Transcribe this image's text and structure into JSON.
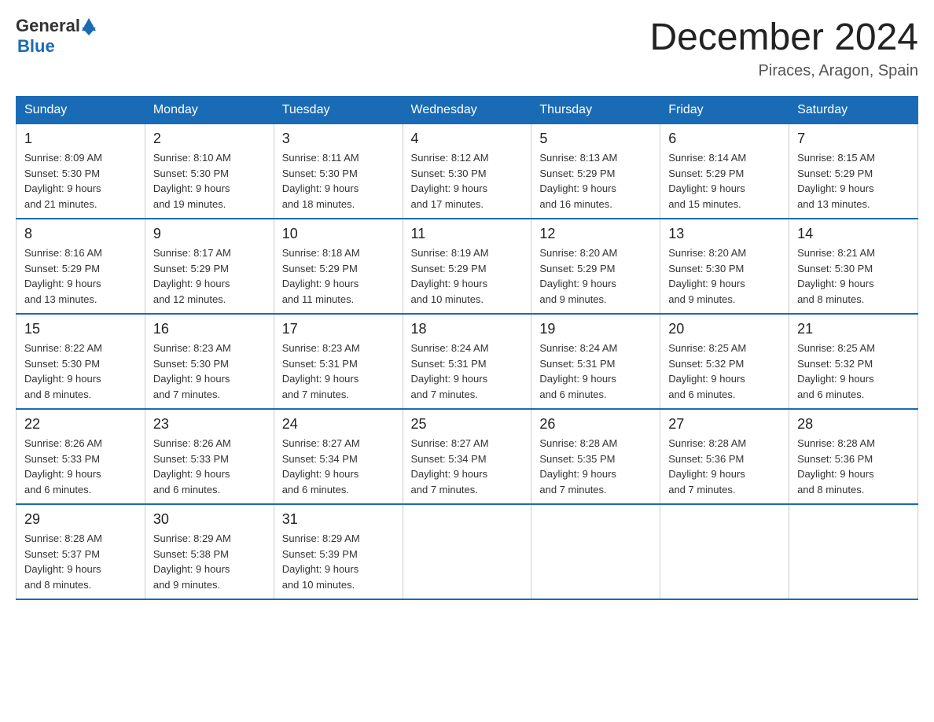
{
  "logo": {
    "general": "General",
    "blue": "Blue"
  },
  "header": {
    "month_year": "December 2024",
    "location": "Piraces, Aragon, Spain"
  },
  "weekdays": [
    "Sunday",
    "Monday",
    "Tuesday",
    "Wednesday",
    "Thursday",
    "Friday",
    "Saturday"
  ],
  "weeks": [
    [
      {
        "day": "1",
        "sunrise": "8:09 AM",
        "sunset": "5:30 PM",
        "daylight": "9 hours and 21 minutes."
      },
      {
        "day": "2",
        "sunrise": "8:10 AM",
        "sunset": "5:30 PM",
        "daylight": "9 hours and 19 minutes."
      },
      {
        "day": "3",
        "sunrise": "8:11 AM",
        "sunset": "5:30 PM",
        "daylight": "9 hours and 18 minutes."
      },
      {
        "day": "4",
        "sunrise": "8:12 AM",
        "sunset": "5:30 PM",
        "daylight": "9 hours and 17 minutes."
      },
      {
        "day": "5",
        "sunrise": "8:13 AM",
        "sunset": "5:29 PM",
        "daylight": "9 hours and 16 minutes."
      },
      {
        "day": "6",
        "sunrise": "8:14 AM",
        "sunset": "5:29 PM",
        "daylight": "9 hours and 15 minutes."
      },
      {
        "day": "7",
        "sunrise": "8:15 AM",
        "sunset": "5:29 PM",
        "daylight": "9 hours and 13 minutes."
      }
    ],
    [
      {
        "day": "8",
        "sunrise": "8:16 AM",
        "sunset": "5:29 PM",
        "daylight": "9 hours and 13 minutes."
      },
      {
        "day": "9",
        "sunrise": "8:17 AM",
        "sunset": "5:29 PM",
        "daylight": "9 hours and 12 minutes."
      },
      {
        "day": "10",
        "sunrise": "8:18 AM",
        "sunset": "5:29 PM",
        "daylight": "9 hours and 11 minutes."
      },
      {
        "day": "11",
        "sunrise": "8:19 AM",
        "sunset": "5:29 PM",
        "daylight": "9 hours and 10 minutes."
      },
      {
        "day": "12",
        "sunrise": "8:20 AM",
        "sunset": "5:29 PM",
        "daylight": "9 hours and 9 minutes."
      },
      {
        "day": "13",
        "sunrise": "8:20 AM",
        "sunset": "5:30 PM",
        "daylight": "9 hours and 9 minutes."
      },
      {
        "day": "14",
        "sunrise": "8:21 AM",
        "sunset": "5:30 PM",
        "daylight": "9 hours and 8 minutes."
      }
    ],
    [
      {
        "day": "15",
        "sunrise": "8:22 AM",
        "sunset": "5:30 PM",
        "daylight": "9 hours and 8 minutes."
      },
      {
        "day": "16",
        "sunrise": "8:23 AM",
        "sunset": "5:30 PM",
        "daylight": "9 hours and 7 minutes."
      },
      {
        "day": "17",
        "sunrise": "8:23 AM",
        "sunset": "5:31 PM",
        "daylight": "9 hours and 7 minutes."
      },
      {
        "day": "18",
        "sunrise": "8:24 AM",
        "sunset": "5:31 PM",
        "daylight": "9 hours and 7 minutes."
      },
      {
        "day": "19",
        "sunrise": "8:24 AM",
        "sunset": "5:31 PM",
        "daylight": "9 hours and 6 minutes."
      },
      {
        "day": "20",
        "sunrise": "8:25 AM",
        "sunset": "5:32 PM",
        "daylight": "9 hours and 6 minutes."
      },
      {
        "day": "21",
        "sunrise": "8:25 AM",
        "sunset": "5:32 PM",
        "daylight": "9 hours and 6 minutes."
      }
    ],
    [
      {
        "day": "22",
        "sunrise": "8:26 AM",
        "sunset": "5:33 PM",
        "daylight": "9 hours and 6 minutes."
      },
      {
        "day": "23",
        "sunrise": "8:26 AM",
        "sunset": "5:33 PM",
        "daylight": "9 hours and 6 minutes."
      },
      {
        "day": "24",
        "sunrise": "8:27 AM",
        "sunset": "5:34 PM",
        "daylight": "9 hours and 6 minutes."
      },
      {
        "day": "25",
        "sunrise": "8:27 AM",
        "sunset": "5:34 PM",
        "daylight": "9 hours and 7 minutes."
      },
      {
        "day": "26",
        "sunrise": "8:28 AM",
        "sunset": "5:35 PM",
        "daylight": "9 hours and 7 minutes."
      },
      {
        "day": "27",
        "sunrise": "8:28 AM",
        "sunset": "5:36 PM",
        "daylight": "9 hours and 7 minutes."
      },
      {
        "day": "28",
        "sunrise": "8:28 AM",
        "sunset": "5:36 PM",
        "daylight": "9 hours and 8 minutes."
      }
    ],
    [
      {
        "day": "29",
        "sunrise": "8:28 AM",
        "sunset": "5:37 PM",
        "daylight": "9 hours and 8 minutes."
      },
      {
        "day": "30",
        "sunrise": "8:29 AM",
        "sunset": "5:38 PM",
        "daylight": "9 hours and 9 minutes."
      },
      {
        "day": "31",
        "sunrise": "8:29 AM",
        "sunset": "5:39 PM",
        "daylight": "9 hours and 10 minutes."
      },
      null,
      null,
      null,
      null
    ]
  ],
  "labels": {
    "sunrise": "Sunrise:",
    "sunset": "Sunset:",
    "daylight": "Daylight:"
  }
}
